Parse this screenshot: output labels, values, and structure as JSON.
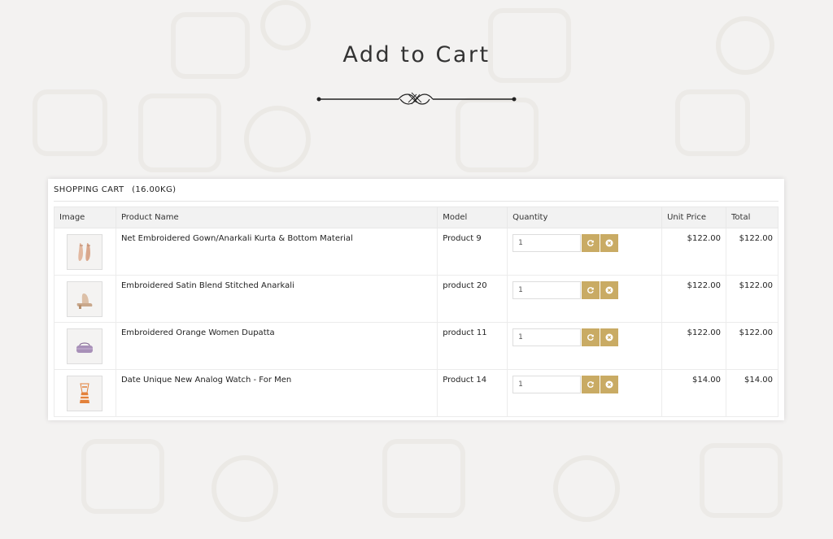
{
  "page": {
    "title": "Add to Cart"
  },
  "cart": {
    "heading": "SHOPPING CART",
    "weight": "(16.00KG)",
    "columns": {
      "image": "Image",
      "name": "Product Name",
      "model": "Model",
      "quantity": "Quantity",
      "unit_price": "Unit Price",
      "total": "Total"
    },
    "items": [
      {
        "name": "Net Embroidered Gown/Anarkali Kurta & Bottom Material",
        "model": "Product 9",
        "quantity": "1",
        "unit_price": "$122.00",
        "total": "$122.00",
        "image_icon": "heels-icon"
      },
      {
        "name": "Embroidered Satin Blend Stitched Anarkali",
        "model": "product 20",
        "quantity": "1",
        "unit_price": "$122.00",
        "total": "$122.00",
        "image_icon": "sandal-icon"
      },
      {
        "name": "Embroidered Orange Women Dupatta",
        "model": "product 11",
        "quantity": "1",
        "unit_price": "$122.00",
        "total": "$122.00",
        "image_icon": "purse-icon"
      },
      {
        "name": "Date Unique New Analog Watch - For Men",
        "model": "Product 14",
        "quantity": "1",
        "unit_price": "$14.00",
        "total": "$14.00",
        "image_icon": "scarf-icon"
      }
    ]
  },
  "colors": {
    "accent": "#c9ab64",
    "background": "#f3f2f1"
  }
}
